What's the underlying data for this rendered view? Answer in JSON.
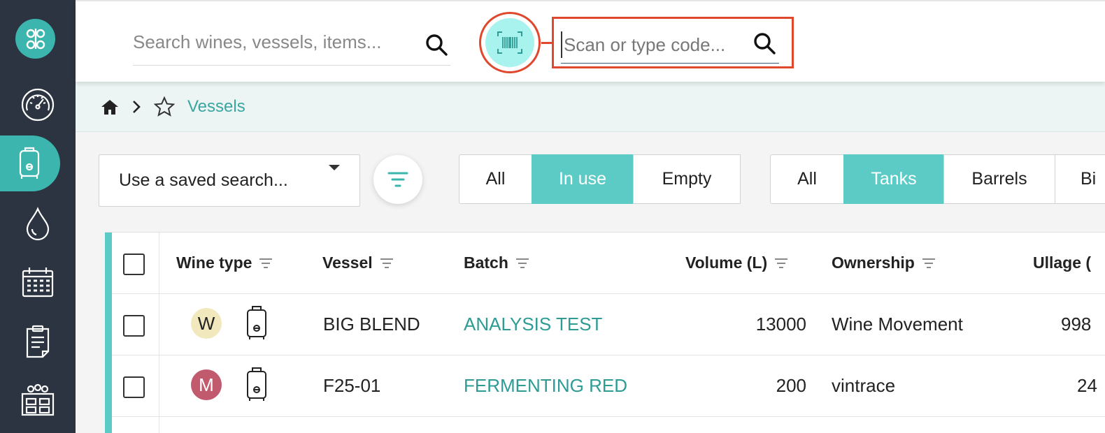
{
  "sidebar": {
    "items": [
      {
        "icon": "dashboard-gauge-icon"
      },
      {
        "icon": "tank-vessel-icon",
        "active": true
      },
      {
        "icon": "wine-drop-icon"
      },
      {
        "icon": "calendar-icon"
      },
      {
        "icon": "clipboard-icon"
      },
      {
        "icon": "winery-building-icon"
      }
    ]
  },
  "header": {
    "search_placeholder": "Search wines, vessels, items...",
    "code_placeholder": "Scan or type code..."
  },
  "breadcrumb": {
    "current": "Vessels"
  },
  "toolbar": {
    "saved_search_label": "Use a saved search...",
    "status_filter": [
      "All",
      "In use",
      "Empty"
    ],
    "status_selected": "In use",
    "type_filter": [
      "All",
      "Tanks",
      "Barrels",
      "Bi"
    ],
    "type_selected": "Tanks"
  },
  "table": {
    "columns": [
      "Wine type",
      "Vessel",
      "Batch",
      "Volume (L)",
      "Ownership",
      "Ullage ("
    ],
    "rows": [
      {
        "wine_type": "W",
        "wine_type_color": "#f2e8bd",
        "vessel": "BIG BLEND",
        "batch": "ANALYSIS TEST",
        "volume": "13000",
        "ownership": "Wine Movement",
        "ullage": "998"
      },
      {
        "wine_type": "M",
        "wine_type_color": "#c25a6e",
        "vessel": "F25-01",
        "batch": "FERMENTING RED",
        "volume": "200",
        "ownership": "vintrace",
        "ullage": "24"
      }
    ]
  },
  "colors": {
    "sidebar_bg": "#2b3440",
    "accent_teal": "#5ccbc6",
    "link_teal": "#2e9c95",
    "highlight_red": "#e0482e"
  }
}
